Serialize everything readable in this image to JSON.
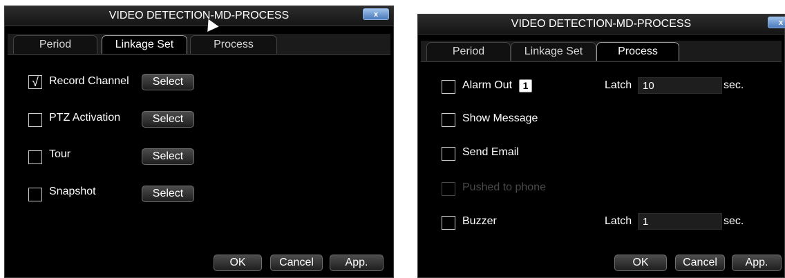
{
  "left_dialog": {
    "title": "VIDEO DETECTION-MD-PROCESS",
    "close_label": "x",
    "tabs": [
      {
        "label": "Period",
        "active": false
      },
      {
        "label": "Linkage Set",
        "active": true
      },
      {
        "label": "Process",
        "active": false
      }
    ],
    "rows": [
      {
        "label": "Record Channel",
        "checked": true,
        "check_glyph": "√",
        "button": "Select"
      },
      {
        "label": "PTZ Activation",
        "checked": false,
        "button": "Select"
      },
      {
        "label": "Tour",
        "checked": false,
        "button": "Select"
      },
      {
        "label": "Snapshot",
        "checked": false,
        "button": "Select"
      }
    ],
    "buttons": {
      "ok": "OK",
      "cancel": "Cancel",
      "apply": "App."
    }
  },
  "right_dialog": {
    "title": "VIDEO DETECTION-MD-PROCESS",
    "close_label": "x",
    "tabs": [
      {
        "label": "Period",
        "active": false
      },
      {
        "label": "Linkage Set",
        "active": false
      },
      {
        "label": "Process",
        "active": true
      }
    ],
    "alarm_out": {
      "label": "Alarm Out",
      "channel": "1",
      "checked": false
    },
    "alarm_latch": {
      "label": "Latch",
      "value": "10",
      "unit": "sec."
    },
    "show_message": {
      "label": "Show Message",
      "checked": false
    },
    "send_email": {
      "label": "Send Email",
      "checked": false
    },
    "pushed_to_phone": {
      "label": "Pushed to phone",
      "checked": false,
      "disabled": true
    },
    "buzzer": {
      "label": "Buzzer",
      "checked": false
    },
    "buzzer_latch": {
      "label": "Latch",
      "value": "1",
      "unit": "sec."
    },
    "buttons": {
      "ok": "OK",
      "cancel": "Cancel",
      "apply": "App."
    }
  },
  "colors": {
    "dialog_bg": "#000000",
    "titlebar": "#222222",
    "tab_active_border": "#9a9a9a",
    "close_button": "#6f97cf",
    "disabled_text": "#4a4a4a"
  },
  "icons": [
    "close-icon",
    "checkmark-icon",
    "mouse-cursor-icon"
  ]
}
